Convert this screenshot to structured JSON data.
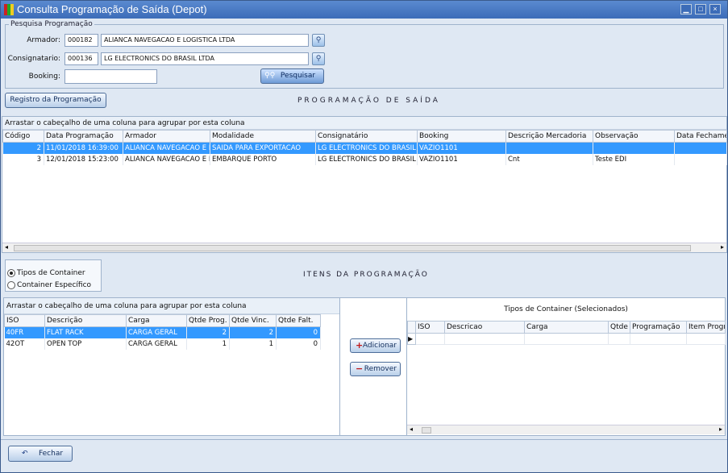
{
  "window": {
    "title": "Consulta Programação de Saída (Depot)",
    "min": "▁",
    "max": "□",
    "close": "×"
  },
  "search": {
    "legend": "Pesquisa Programação",
    "armador_label": "Armador:",
    "armador_code": "000182",
    "armador_name": "ALIANCA NAVEGACAO E LOGISTICA LTDA",
    "consig_label": "Consignatario:",
    "consig_code": "000136",
    "consig_name": "LG ELECTRONICS DO BRASIL LTDA",
    "booking_label": "Booking:",
    "booking_value": "",
    "search_button": "Pesquisar"
  },
  "registro_button": "Registro da Programação",
  "prog_title": "PROGRAMAÇÃO DE SAÍDA",
  "group_hint": "Arrastar o cabeçalho de uma coluna para agrupar por esta coluna",
  "prog_grid": {
    "columns": [
      "Código",
      "Data Programação",
      "Armador",
      "Modalidade",
      "Consignatário",
      "Booking",
      "Descrição Mercadoria",
      "Observação",
      "Data Fechame"
    ],
    "rows": [
      [
        "2",
        "11/01/2018 16:39:00",
        "ALIANCA NAVEGACAO E L",
        "SAIDA PARA EXPORTACAO",
        "LG ELECTRONICS DO BRASIL I",
        "VAZIO1101",
        "",
        "",
        ""
      ],
      [
        "3",
        "12/01/2018 15:23:00",
        "ALIANCA NAVEGACAO E L",
        "EMBARQUE PORTO",
        "LG ELECTRONICS DO BRASIL I",
        "VAZIO1101",
        "Cnt",
        "Teste EDI",
        ""
      ]
    ]
  },
  "radio": {
    "tipos": "Tipos de Container",
    "especifico": "Container Específico"
  },
  "itens_title": "ITENS DA PROGRAMAÇÃO",
  "itens_grid": {
    "columns": [
      "ISO",
      "Descrição",
      "Carga",
      "Qtde Prog.",
      "Qtde Vinc.",
      "Qtde Falt."
    ],
    "rows": [
      [
        "40FR",
        "FLAT RACK",
        "CARGA GERAL",
        "2",
        "2",
        "0"
      ],
      [
        "42OT",
        "OPEN TOP",
        "CARGA GERAL",
        "1",
        "1",
        "0"
      ]
    ]
  },
  "adicionar_button": "Adicionar",
  "remover_button": "Remover",
  "selected_title": "Tipos de Container (Selecionados)",
  "selected_grid": {
    "columns": [
      "ISO",
      "Descricao",
      "Carga",
      "Qtde",
      "Programação",
      "Item Progr"
    ]
  },
  "fechar_button": "Fechar"
}
